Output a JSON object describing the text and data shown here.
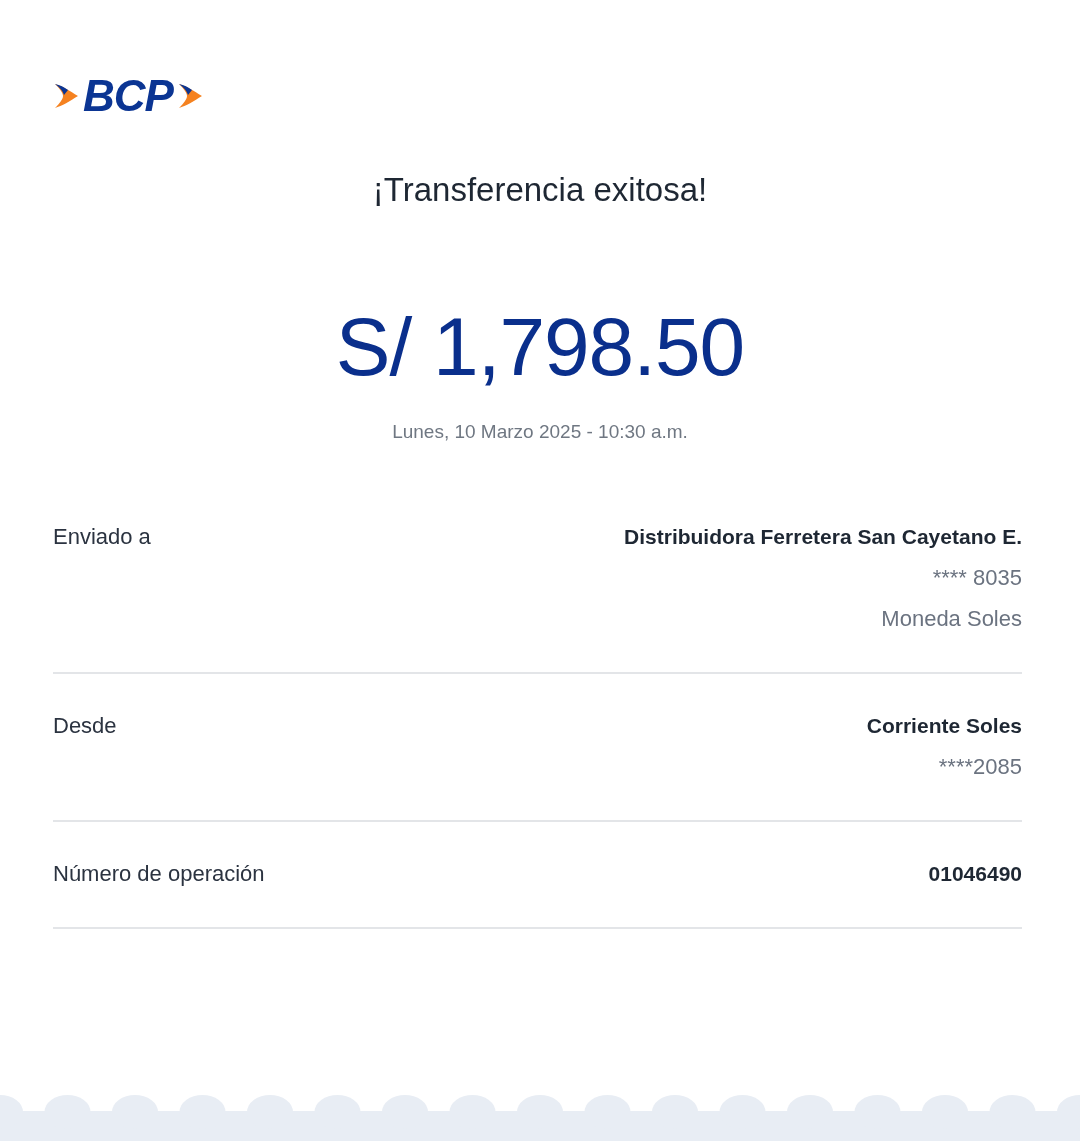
{
  "logo": {
    "text": "BCP"
  },
  "title": "¡Transferencia exitosa!",
  "amount": "S/ 1,798.50",
  "datetime": "Lunes, 10 Marzo 2025 - 10:30 a.m.",
  "details": [
    {
      "label": "Enviado a",
      "lines": [
        {
          "text": "Distribuidora Ferretera San Cayetano E.",
          "kind": "primary"
        },
        {
          "text": "**** 8035",
          "kind": "secondary"
        },
        {
          "text": "Moneda Soles",
          "kind": "secondary"
        }
      ]
    },
    {
      "label": "Desde",
      "lines": [
        {
          "text": "Corriente Soles",
          "kind": "primary"
        },
        {
          "text": "****2085",
          "kind": "secondary"
        }
      ]
    },
    {
      "label": "Número de operación",
      "lines": [
        {
          "text": "01046490",
          "kind": "primary"
        }
      ]
    }
  ]
}
